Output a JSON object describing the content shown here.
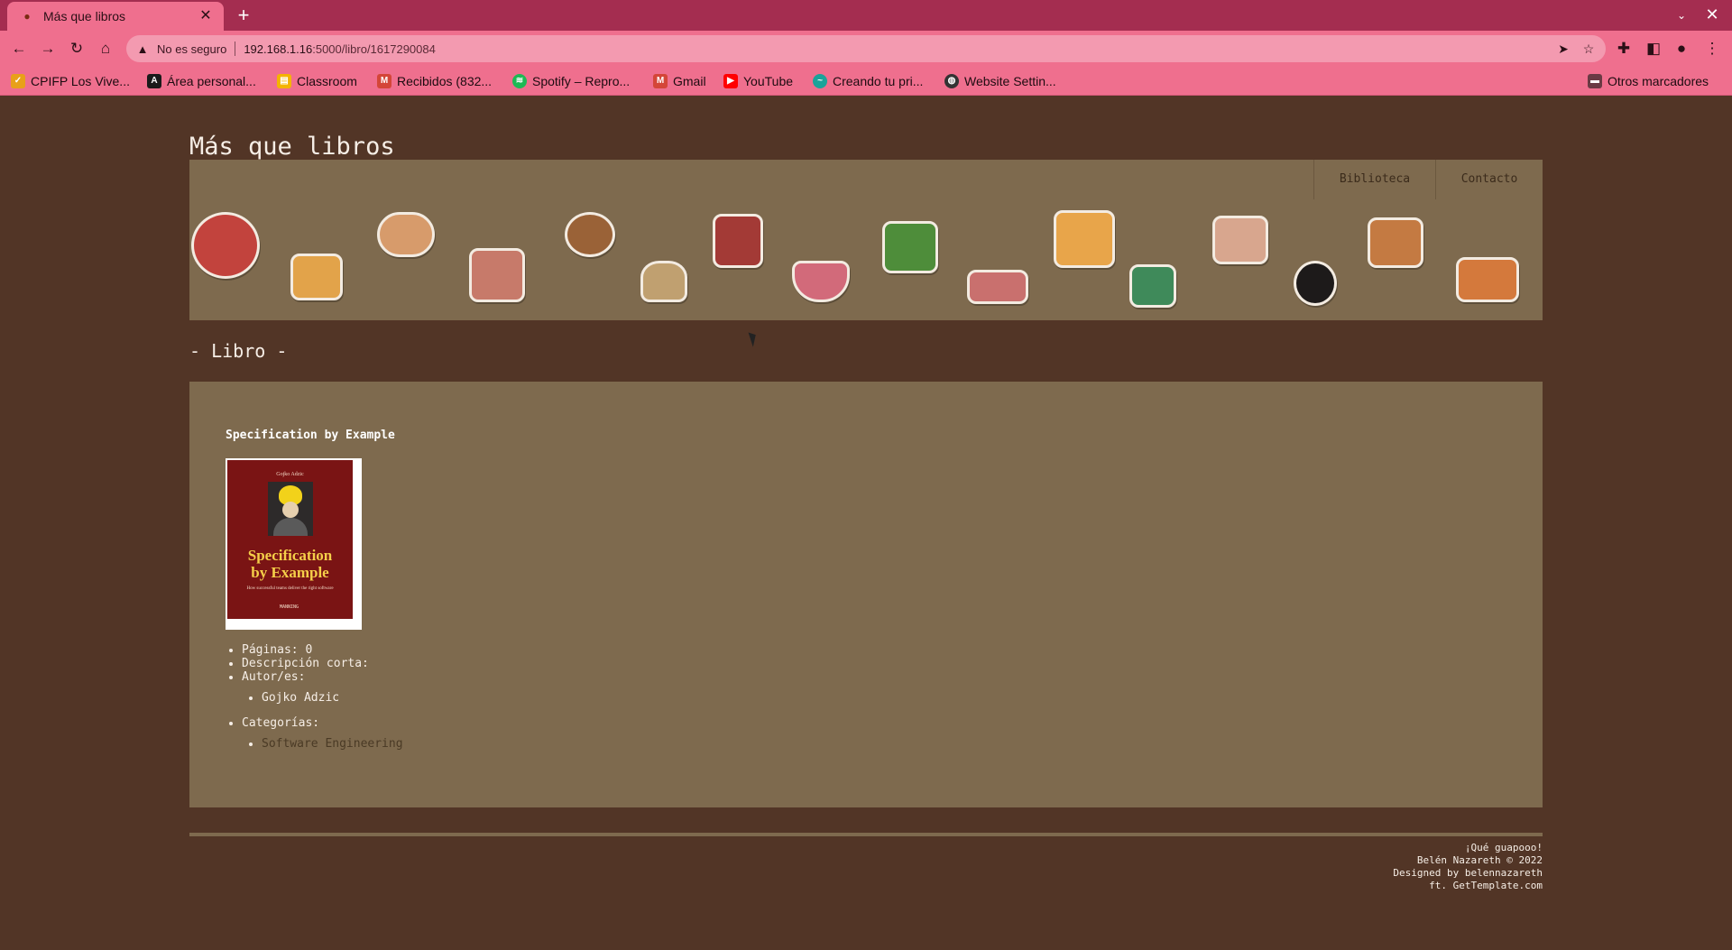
{
  "browser": {
    "tab": {
      "title": "Más que libros",
      "favicon": "site-favicon-icon"
    },
    "address_bar": {
      "security_text": "No es seguro",
      "url_host": "192.168.1.16",
      "url_path": ":5000/libro/1617290084"
    },
    "bookmarks": [
      {
        "label": "CPIFP Los Vive...",
        "icon": "cpifp-icon",
        "color": "#e8a019"
      },
      {
        "label": "Área personal...",
        "icon": "moodle-icon",
        "color": "#1a1a1a"
      },
      {
        "label": "Classroom",
        "icon": "classroom-icon",
        "color": "#f4b400"
      },
      {
        "label": "Recibidos (832...",
        "icon": "gmail-icon",
        "color": "#d44638"
      },
      {
        "label": "Spotify – Repro...",
        "icon": "spotify-icon",
        "color": "#1db954"
      },
      {
        "label": "Gmail",
        "icon": "gmail-icon",
        "color": "#d44638"
      },
      {
        "label": "YouTube",
        "icon": "youtube-icon",
        "color": "#ff0000"
      },
      {
        "label": "Creando tu pri...",
        "icon": "creando-icon",
        "color": "#1aa39a"
      },
      {
        "label": "Website Settin...",
        "icon": "globe-icon",
        "color": "#333333"
      }
    ],
    "other_bookmarks": "Otros marcadores"
  },
  "site": {
    "title": "Más que libros",
    "nav": [
      "Biblioteca",
      "Contacto"
    ],
    "section_title": "- Libro -"
  },
  "book": {
    "title": "Specification by Example",
    "cover": {
      "author": "Gojko Adzic",
      "title_line1": "Specification",
      "title_line2": "by Example",
      "subtitle": "How successful teams deliver the right software",
      "publisher": "MANNING"
    },
    "pages_label": "Páginas: 0",
    "short_description_label": "Descripción corta:",
    "authors_label": "Autor/es:",
    "authors": [
      "Gojko Adzic"
    ],
    "categories_label": "Categorías:",
    "categories": [
      "Software Engineering"
    ]
  },
  "footer": {
    "lines": [
      "¡Qué guapooo!",
      "Belén Nazareth © 2022",
      "Designed by belennazareth",
      "ft. GetTemplate.com"
    ]
  },
  "colors": {
    "tab_strip": "#a42d50",
    "toolbar": "#ef6f8e",
    "page_background": "#523526",
    "panel": "#7e6a4e"
  }
}
